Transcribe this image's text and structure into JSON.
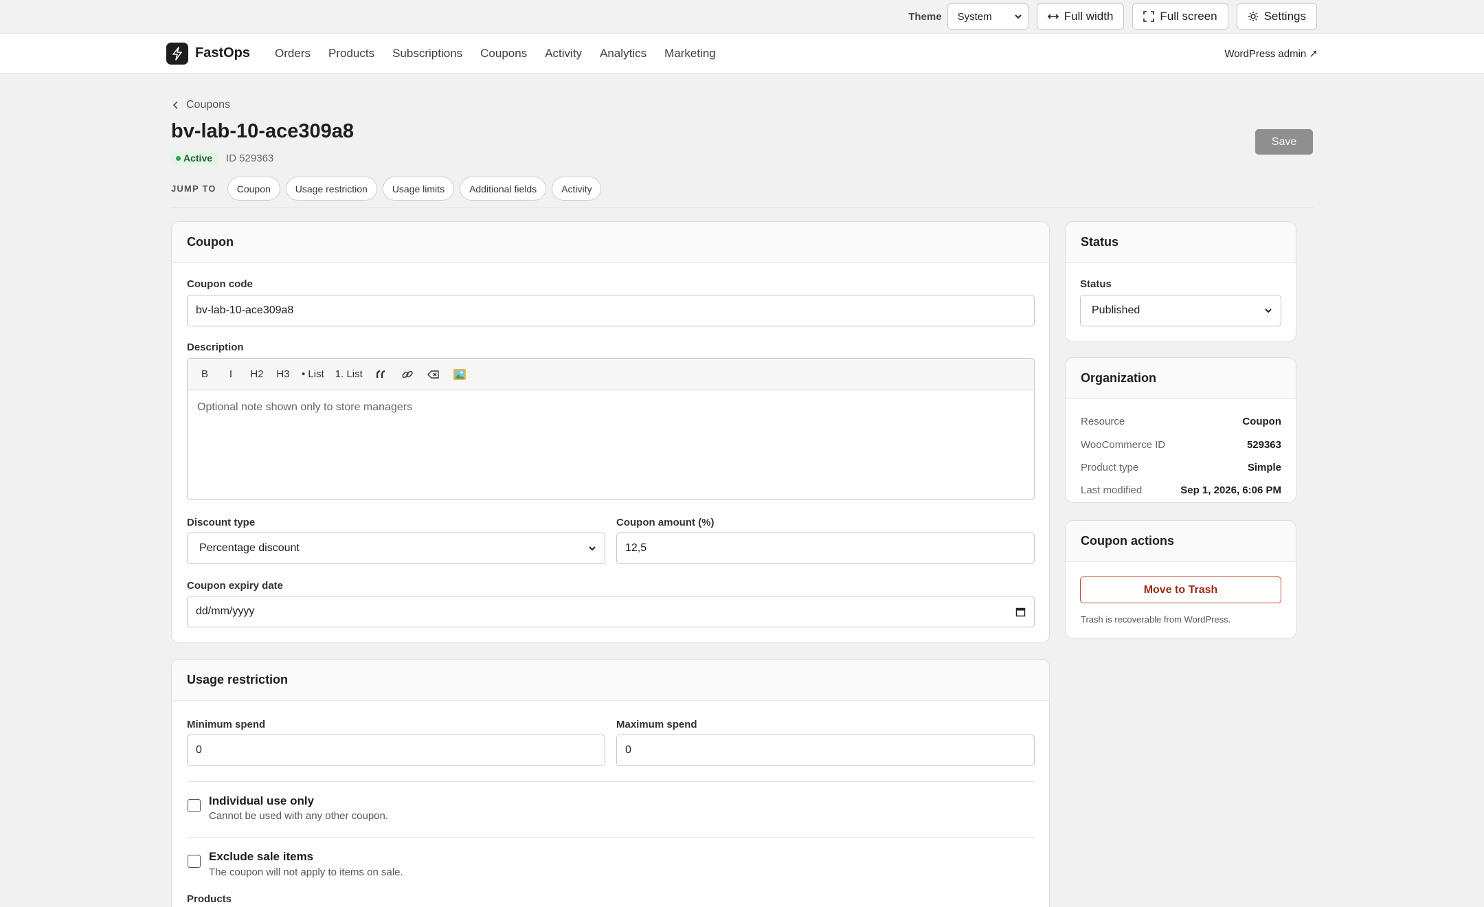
{
  "topbar": {
    "theme_label": "Theme",
    "theme_value": "System",
    "full_width": "Full width",
    "full_screen": "Full screen",
    "settings": "Settings"
  },
  "nav": {
    "brand": "FastOps",
    "items": [
      "Orders",
      "Products",
      "Subscriptions",
      "Coupons",
      "Activity",
      "Analytics",
      "Marketing"
    ],
    "admin_link": "WordPress admin ↗"
  },
  "header": {
    "breadcrumb": "Coupons",
    "title": "bv-lab-10-ace309a8",
    "status_badge": "Active",
    "id_text": "ID 529363",
    "save": "Save",
    "jump_label": "JUMP TO",
    "jump_links": [
      "Coupon",
      "Usage restriction",
      "Usage limits",
      "Additional fields",
      "Activity"
    ]
  },
  "coupon_card": {
    "title": "Coupon",
    "code_label": "Coupon code",
    "code_value": "bv-lab-10-ace309a8",
    "description_label": "Description",
    "toolbar": [
      "B",
      "I",
      "H2",
      "H3",
      "• List",
      "1. List"
    ],
    "description_placeholder": "Optional note shown only to store managers",
    "discount_type_label": "Discount type",
    "discount_type_value": "Percentage discount",
    "amount_label": "Coupon amount (%)",
    "amount_value": "12,5",
    "expiry_label": "Coupon expiry date",
    "expiry_placeholder": "dd/mm/yyyy"
  },
  "status_card": {
    "title": "Status",
    "status_label": "Status",
    "status_value": "Published"
  },
  "org_card": {
    "title": "Organization",
    "rows": [
      {
        "k": "Resource",
        "v": "Coupon"
      },
      {
        "k": "WooCommerce ID",
        "v": "529363"
      },
      {
        "k": "Product type",
        "v": "Simple"
      },
      {
        "k": "Last modified",
        "v": "Sep 1, 2026, 6:06 PM"
      }
    ]
  },
  "actions_card": {
    "title": "Coupon actions",
    "trash": "Move to Trash",
    "note": "Trash is recoverable from WordPress."
  },
  "restriction_card": {
    "title": "Usage restriction",
    "min_label": "Minimum spend",
    "min_value": "0",
    "max_label": "Maximum spend",
    "max_value": "0",
    "individual_title": "Individual use only",
    "individual_desc": "Cannot be used with any other coupon.",
    "exclude_title": "Exclude sale items",
    "exclude_desc": "The coupon will not apply to items on sale.",
    "products_label": "Products"
  }
}
